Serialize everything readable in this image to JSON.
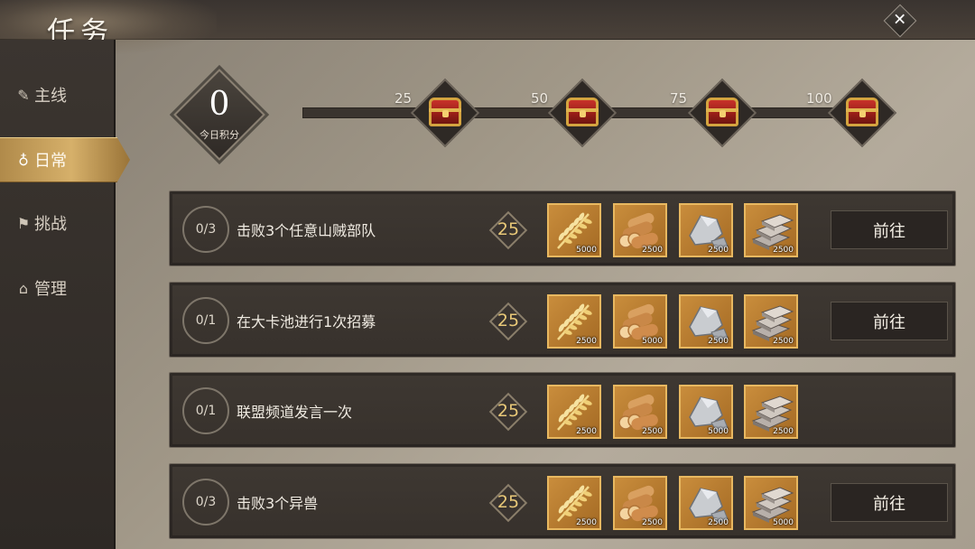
{
  "title": "任务",
  "close_label": "✕",
  "sidebar": {
    "items": [
      {
        "label": "主线",
        "icon": "quill-icon",
        "glyph": "✎"
      },
      {
        "label": "日常",
        "icon": "gourd-icon",
        "glyph": "♁"
      },
      {
        "label": "挑战",
        "icon": "flag-icon",
        "glyph": "⚑"
      },
      {
        "label": "管理",
        "icon": "building-icon",
        "glyph": "⌂"
      }
    ],
    "active_index": 1
  },
  "progress": {
    "score": "0",
    "score_label": "今日积分",
    "milestones": [
      "25",
      "50",
      "75",
      "100"
    ]
  },
  "tasks": [
    {
      "progress": "0/3",
      "desc": "击败3个任意山贼部队",
      "points": "25",
      "rewards": [
        {
          "type": "grain",
          "amount": "5000"
        },
        {
          "type": "wood",
          "amount": "2500"
        },
        {
          "type": "stone",
          "amount": "2500"
        },
        {
          "type": "iron",
          "amount": "2500"
        }
      ],
      "button": "前往"
    },
    {
      "progress": "0/1",
      "desc": "在大卡池进行1次招募",
      "points": "25",
      "rewards": [
        {
          "type": "grain",
          "amount": "2500"
        },
        {
          "type": "wood",
          "amount": "5000"
        },
        {
          "type": "stone",
          "amount": "2500"
        },
        {
          "type": "iron",
          "amount": "2500"
        }
      ],
      "button": "前往"
    },
    {
      "progress": "0/1",
      "desc": "联盟频道发言一次",
      "points": "25",
      "rewards": [
        {
          "type": "grain",
          "amount": "2500"
        },
        {
          "type": "wood",
          "amount": "2500"
        },
        {
          "type": "stone",
          "amount": "5000"
        },
        {
          "type": "iron",
          "amount": "2500"
        }
      ],
      "button": ""
    },
    {
      "progress": "0/3",
      "desc": "击败3个异兽",
      "points": "25",
      "rewards": [
        {
          "type": "grain",
          "amount": "2500"
        },
        {
          "type": "wood",
          "amount": "2500"
        },
        {
          "type": "stone",
          "amount": "2500"
        },
        {
          "type": "iron",
          "amount": "5000"
        }
      ],
      "button": "前往"
    }
  ]
}
